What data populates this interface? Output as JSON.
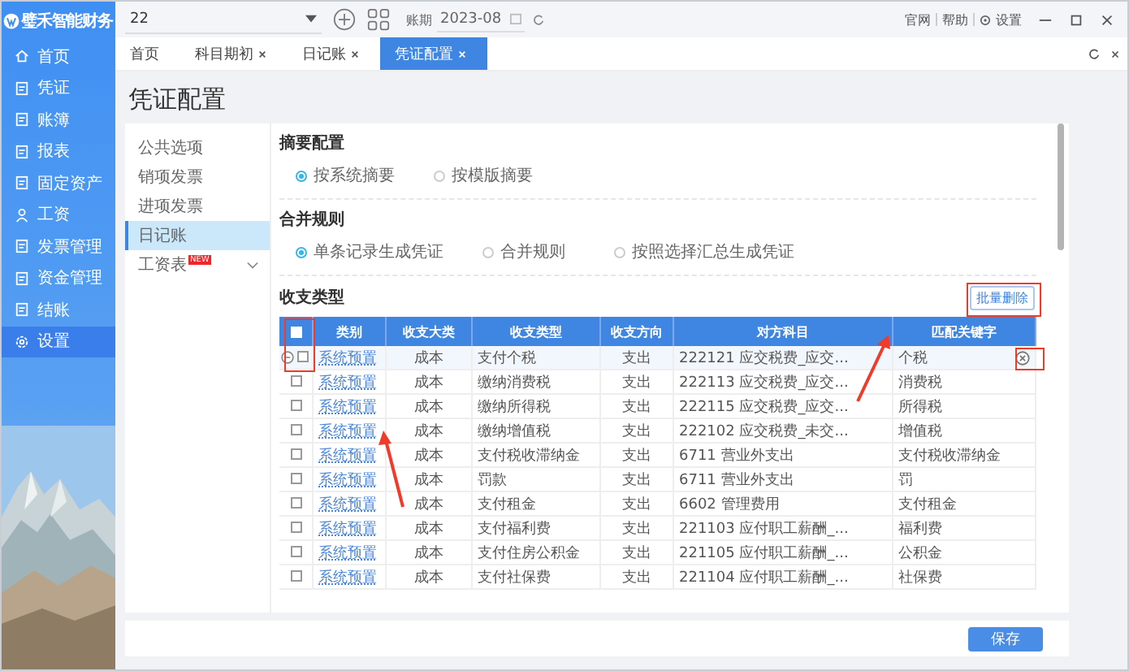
{
  "app": {
    "logo": "璧禾智能财务"
  },
  "sidebar": {
    "items": [
      {
        "label": "首页",
        "selected": false
      },
      {
        "label": "凭证",
        "selected": false
      },
      {
        "label": "账簿",
        "selected": false
      },
      {
        "label": "报表",
        "selected": false
      },
      {
        "label": "固定资产",
        "selected": false
      },
      {
        "label": "工资",
        "selected": false
      },
      {
        "label": "发票管理",
        "selected": false
      },
      {
        "label": "资金管理",
        "selected": false
      },
      {
        "label": "结账",
        "selected": false
      },
      {
        "label": "设置",
        "selected": true
      }
    ]
  },
  "toolbar": {
    "company": "22",
    "period_label": "账期",
    "period": "2023-08",
    "links": [
      "官网",
      "帮助",
      "设置"
    ]
  },
  "tabs": [
    {
      "label": "首页",
      "closable": false,
      "selected": false
    },
    {
      "label": "科目期初",
      "closable": true,
      "selected": false
    },
    {
      "label": "日记账",
      "closable": true,
      "selected": false
    },
    {
      "label": "凭证配置",
      "closable": true,
      "selected": true
    }
  ],
  "page": {
    "title": "凭证配置"
  },
  "menu": [
    {
      "label": "公共选项",
      "selected": false
    },
    {
      "label": "销项发票",
      "selected": false
    },
    {
      "label": "进项发票",
      "selected": false
    },
    {
      "label": "日记账",
      "selected": true
    },
    {
      "label": "工资表",
      "selected": false,
      "badge": "NEW",
      "expandable": true
    }
  ],
  "summary": {
    "title": "摘要配置",
    "options": [
      {
        "label": "按系统摘要",
        "selected": true
      },
      {
        "label": "按模版摘要",
        "selected": false
      }
    ]
  },
  "merge": {
    "title": "合并规则",
    "options": [
      {
        "label": "单条记录生成凭证",
        "selected": true
      },
      {
        "label": "合并规则",
        "selected": false
      },
      {
        "label": "按照选择汇总生成凭证",
        "selected": false
      }
    ]
  },
  "types": {
    "title": "收支类型",
    "batch_delete": "批量删除",
    "select_all": false,
    "columns": [
      "类别",
      "收支大类",
      "收支类型",
      "收支方向",
      "对方科目",
      "匹配关键字"
    ],
    "rows": [
      {
        "checked": false,
        "hover": true,
        "cells": [
          "系统预置",
          "成本",
          "支付个税",
          "支出",
          "222121 应交税费_应交...",
          "个税"
        ]
      },
      {
        "checked": false,
        "hover": false,
        "cells": [
          "系统预置",
          "成本",
          "缴纳消费税",
          "支出",
          "222113 应交税费_应交...",
          "消费税"
        ]
      },
      {
        "checked": false,
        "hover": false,
        "cells": [
          "系统预置",
          "成本",
          "缴纳所得税",
          "支出",
          "222115 应交税费_应交...",
          "所得税"
        ]
      },
      {
        "checked": false,
        "hover": false,
        "cells": [
          "系统预置",
          "成本",
          "缴纳增值税",
          "支出",
          "222102 应交税费_未交...",
          "增值税"
        ]
      },
      {
        "checked": false,
        "hover": false,
        "cells": [
          "系统预置",
          "成本",
          "支付税收滞纳金",
          "支出",
          "6711 营业外支出",
          "支付税收滞纳金"
        ]
      },
      {
        "checked": false,
        "hover": false,
        "cells": [
          "系统预置",
          "成本",
          "罚款",
          "支出",
          "6711 营业外支出",
          "罚"
        ]
      },
      {
        "checked": false,
        "hover": false,
        "cells": [
          "系统预置",
          "成本",
          "支付租金",
          "支出",
          "6602 管理费用",
          "支付租金"
        ]
      },
      {
        "checked": false,
        "hover": false,
        "cells": [
          "系统预置",
          "成本",
          "支付福利费",
          "支出",
          "221103 应付职工薪酬_...",
          "福利费"
        ]
      },
      {
        "checked": false,
        "hover": false,
        "cells": [
          "系统预置",
          "成本",
          "支付住房公积金",
          "支出",
          "221105 应付职工薪酬_...",
          "公积金"
        ]
      },
      {
        "checked": false,
        "hover": false,
        "cells": [
          "系统预置",
          "成本",
          "支付社保费",
          "支出",
          "221104 应付职工薪酬_...",
          "社保费"
        ]
      }
    ]
  },
  "save": "保存"
}
